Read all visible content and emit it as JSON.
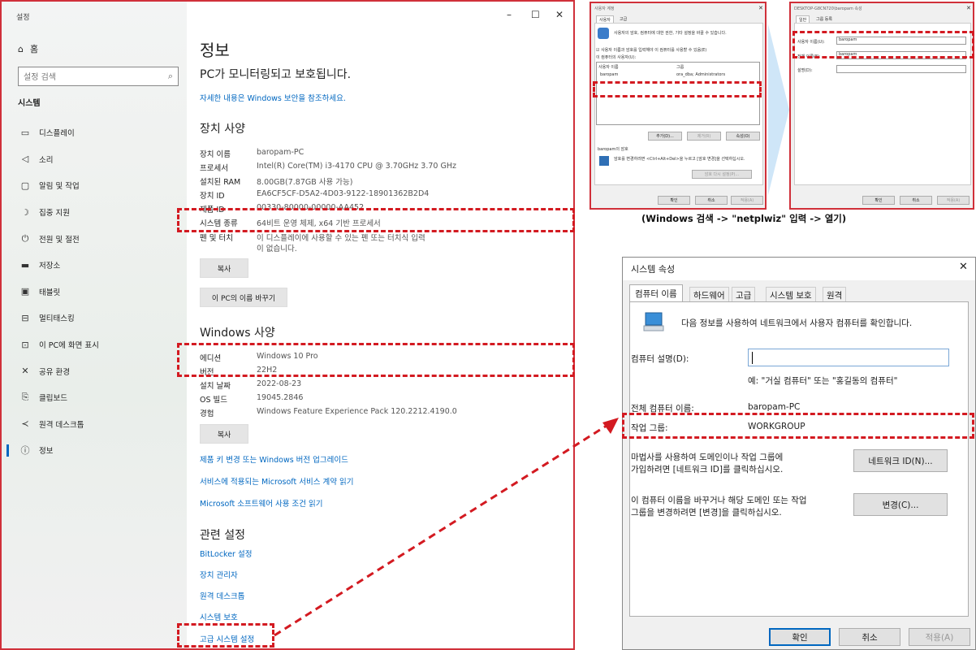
{
  "settings": {
    "window_label": "설정",
    "home": "홈",
    "search_placeholder": "설정 검색",
    "section": "시스템",
    "nav": [
      {
        "label": "디스플레이",
        "icon": "display-icon"
      },
      {
        "label": "소리",
        "icon": "speaker-icon"
      },
      {
        "label": "알림 및 작업",
        "icon": "notification-icon"
      },
      {
        "label": "집중 지원",
        "icon": "moon-icon"
      },
      {
        "label": "전원 및 절전",
        "icon": "power-icon"
      },
      {
        "label": "저장소",
        "icon": "storage-icon"
      },
      {
        "label": "태블릿",
        "icon": "tablet-icon"
      },
      {
        "label": "멀티태스킹",
        "icon": "multitask-icon"
      },
      {
        "label": "이 PC에 화면 표시",
        "icon": "project-icon"
      },
      {
        "label": "공유 환경",
        "icon": "share-icon"
      },
      {
        "label": "클립보드",
        "icon": "clipboard-icon"
      },
      {
        "label": "원격 데스크톱",
        "icon": "remote-icon"
      },
      {
        "label": "정보",
        "icon": "info-icon"
      }
    ],
    "window_controls": {
      "minimize": "–",
      "maximize": "☐",
      "close": "✕"
    },
    "title": "정보",
    "protected": "PC가 모니터링되고 보호됩니다.",
    "security_link": "자세한 내용은 Windows 보안을 참조하세요.",
    "device_specs_title": "장치 사양",
    "device_specs": [
      {
        "label": "장치 이름",
        "value": "baropam-PC"
      },
      {
        "label": "프로세서",
        "value": "Intel(R) Core(TM) i3-4170 CPU @ 3.70GHz   3.70 GHz"
      },
      {
        "label": "설치된 RAM",
        "value": "8.00GB(7.87GB 사용 가능)"
      },
      {
        "label": "장치 ID",
        "value": "EA6CF5CF-D5A2-4D03-9122-18901362B2D4"
      },
      {
        "label": "제품 ID",
        "value": "00330-80000-00000-AA452"
      },
      {
        "label": "시스템 종류",
        "value": "64비트 운영 체제, x64 기반 프로세서"
      },
      {
        "label": "펜 및 터치",
        "value": "이 디스플레이에 사용할 수 있는 펜 또는 터치식 입력"
      },
      {
        "label": "",
        "value": "이 없습니다."
      }
    ],
    "copy_button": "복사",
    "rename_button": "이 PC의 이름 바꾸기",
    "windows_specs_title": "Windows 사양",
    "windows_specs": [
      {
        "label": "에디션",
        "value": "Windows 10 Pro"
      },
      {
        "label": "버전",
        "value": "22H2"
      },
      {
        "label": "설치 날짜",
        "value": "2022-08-23"
      },
      {
        "label": "OS 빌드",
        "value": "19045.2846"
      },
      {
        "label": "경험",
        "value": "Windows Feature Experience Pack 120.2212.4190.0"
      }
    ],
    "copy_button2": "복사",
    "links": [
      "제품 키 변경 또는 Windows 버전 업그레이드",
      "서비스에 적용되는 Microsoft 서비스 계약 읽기",
      "Microsoft 소프트웨어 사용 조건 읽기"
    ],
    "related_title": "관련 설정",
    "related_links": [
      "BitLocker 설정",
      "장치 관리자",
      "원격 데스크톱",
      "시스템 보호",
      "고급 시스템 설정"
    ]
  },
  "user_accounts": {
    "title": "사용자 계정",
    "tabs": [
      "사용자",
      "고급"
    ],
    "description": "사용자의 암호, 컴퓨터에 대한 권한, 기타 설정을 바꿀 수 있습니다.",
    "checkbox_label": "사용자 이름과 암호를 입력해야 이 컴퓨터를 사용할 수 있음(E)",
    "users_label": "이 컴퓨터의 사용자(U):",
    "columns": [
      "사용자 이름",
      "그룹"
    ],
    "rows": [
      {
        "name": "baropam",
        "group": "ora_dba; Administrators"
      }
    ],
    "buttons": [
      "추가(D)...",
      "제거(R)",
      "속성(O)"
    ],
    "password_group": "baropam의 암호",
    "password_text": "암호를 변경하려면 <Ctrl+Alt+Del>을 누르고 [암호 변경]을 선택하십시오.",
    "reset_password": "암호 다시 설정(P)...",
    "ok": "확인",
    "cancel": "취소",
    "apply": "적용(A)"
  },
  "user_props": {
    "title": "DESKTOP-G8CN720\\baropam 속성",
    "tabs": [
      "일반",
      "그룹 등록"
    ],
    "username_label": "사용자 이름(U):",
    "username_value": "baropam",
    "fullname_label": "전체 이름(F):",
    "fullname_value": "baropam",
    "desc_label": "설명(D):",
    "ok": "확인",
    "cancel": "취소",
    "apply": "적용(A)"
  },
  "caption": "(Windows 검색 -> \"netplwiz\" 입력 -> 열기)",
  "system_props": {
    "title": "시스템 속성",
    "close": "✕",
    "tabs": [
      "컴퓨터 이름",
      "하드웨어",
      "고급",
      "시스템 보호",
      "원격"
    ],
    "intro": "다음 정보를 사용하여 네트워크에서 사용자 컴퓨터를 확인합니다.",
    "desc_label": "컴퓨터 설명(D):",
    "desc_hint": "예: \"거실 컴퓨터\" 또는 \"홍길동의 컴퓨터\"",
    "fullname_label": "전체 컴퓨터 이름:",
    "fullname_value": "baropam-PC",
    "workgroup_label": "작업 그룹:",
    "workgroup_value": "WORKGROUP",
    "wizard_text_1": "마법사를 사용하여 도메인이나 작업 그룹에",
    "wizard_text_2": "가입하려면 [네트워크 ID]를 클릭하십시오.",
    "network_id_button": "네트워크 ID(N)...",
    "rename_text_1": "이 컴퓨터 이름을 바꾸거나 해당 도메인 또는 작업",
    "rename_text_2": "그룹을 변경하려면 [변경]을 클릭하십시오.",
    "change_button": "변경(C)...",
    "ok": "확인",
    "cancel": "취소",
    "apply": "적용(A)"
  },
  "colors": {
    "accent": "#0067c0",
    "highlight": "#d31a21"
  }
}
